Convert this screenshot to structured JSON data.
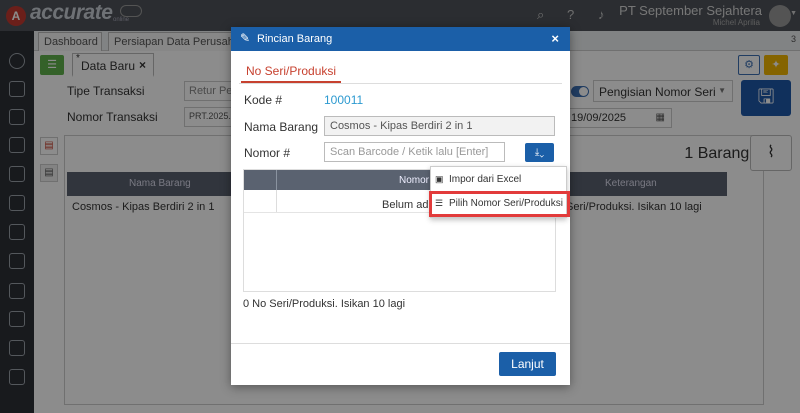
{
  "app": {
    "logo_letter": "A",
    "logo_text": "accurate",
    "logo_sub": "online",
    "company": "PT September Sejahtera",
    "user": "Michel Aprilia"
  },
  "tabs": [
    {
      "label": "Dashboard"
    },
    {
      "label": "Persiapan Data Perusahaan"
    }
  ],
  "tab_count": "3",
  "doc": {
    "star": "*",
    "tab_label": "Data Baru",
    "close": "×"
  },
  "form": {
    "tipe_label": "Tipe Transaksi",
    "tipe_value": "Retur Per",
    "nomor_label": "Nomor Transaksi",
    "nomor_value": "PRT.2025.0",
    "pengisian": "Pengisian Nomor Seri",
    "date": "19/09/2025"
  },
  "main_table": {
    "count_text": "1 Barang",
    "required": "*",
    "col_nama": "Nama Barang",
    "col_keterangan": "Keterangan",
    "row_nama": "Cosmos - Kipas Berdiri 2 in 1",
    "row_keterangan": "Seri/Produksi. Isikan 10 lagi"
  },
  "modal": {
    "title": "Rincian Barang",
    "tab": "No Seri/Produksi",
    "kode_label": "Kode #",
    "kode_value": "100011",
    "nama_label": "Nama Barang",
    "nama_value": "Cosmos - Kipas Berdiri 2 in 1",
    "nomor_label": "Nomor #",
    "nomor_placeholder": "Scan Barcode / Ketik lalu [Enter]",
    "table_header": "Nomor",
    "table_row": "Belum ada",
    "footer_text": "0 No Seri/Produksi. Isikan 10 lagi",
    "button": "Lanjut"
  },
  "dropdown": [
    {
      "label": "Impor dari Excel",
      "icon": "excel-icon"
    },
    {
      "label": "Pilih Nomor Seri/Produksi",
      "icon": "list-icon"
    }
  ],
  "colors": {
    "primary": "#1b5fa8",
    "accent_red": "#c7412f",
    "highlight": "#e23b3b",
    "link": "#2d9ad0"
  }
}
